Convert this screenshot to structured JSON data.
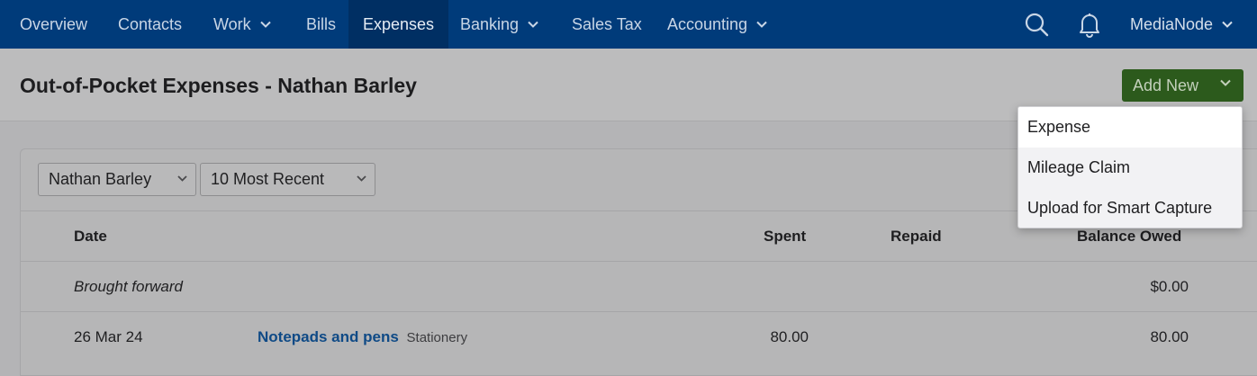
{
  "nav": {
    "items": [
      {
        "label": "Overview",
        "dropdown": false
      },
      {
        "label": "Contacts",
        "dropdown": false
      },
      {
        "label": "Work",
        "dropdown": true
      },
      {
        "label": "Bills",
        "dropdown": false
      },
      {
        "label": "Expenses",
        "dropdown": false,
        "active": true
      },
      {
        "label": "Banking",
        "dropdown": true
      },
      {
        "label": "Sales Tax",
        "dropdown": false
      },
      {
        "label": "Accounting",
        "dropdown": true
      }
    ],
    "icons": [
      "search-icon",
      "bell-icon"
    ],
    "account_label": "MediaNode"
  },
  "page": {
    "title": "Out-of-Pocket Expenses - Nathan Barley",
    "add_new_label": "Add New"
  },
  "add_new_menu": {
    "items": [
      "Expense",
      "Mileage Claim",
      "Upload for Smart Capture"
    ],
    "highlighted_index": 0
  },
  "filters": {
    "person": "Nathan Barley",
    "range": "10 Most Recent"
  },
  "table": {
    "columns": [
      "Date",
      "Spent",
      "Repaid",
      "Balance Owed"
    ],
    "brought_forward": {
      "label": "Brought forward",
      "balance": "$0.00"
    },
    "rows": [
      {
        "date": "26 Mar 24",
        "description": "Notepads and pens",
        "category": "Stationery",
        "spent": "80.00",
        "repaid": "",
        "balance": "80.00"
      }
    ]
  },
  "colors": {
    "nav_bg": "#003b7a",
    "nav_active_bg": "#002f63",
    "add_new_bg": "#2c5a1c",
    "link": "#0f4a86"
  }
}
